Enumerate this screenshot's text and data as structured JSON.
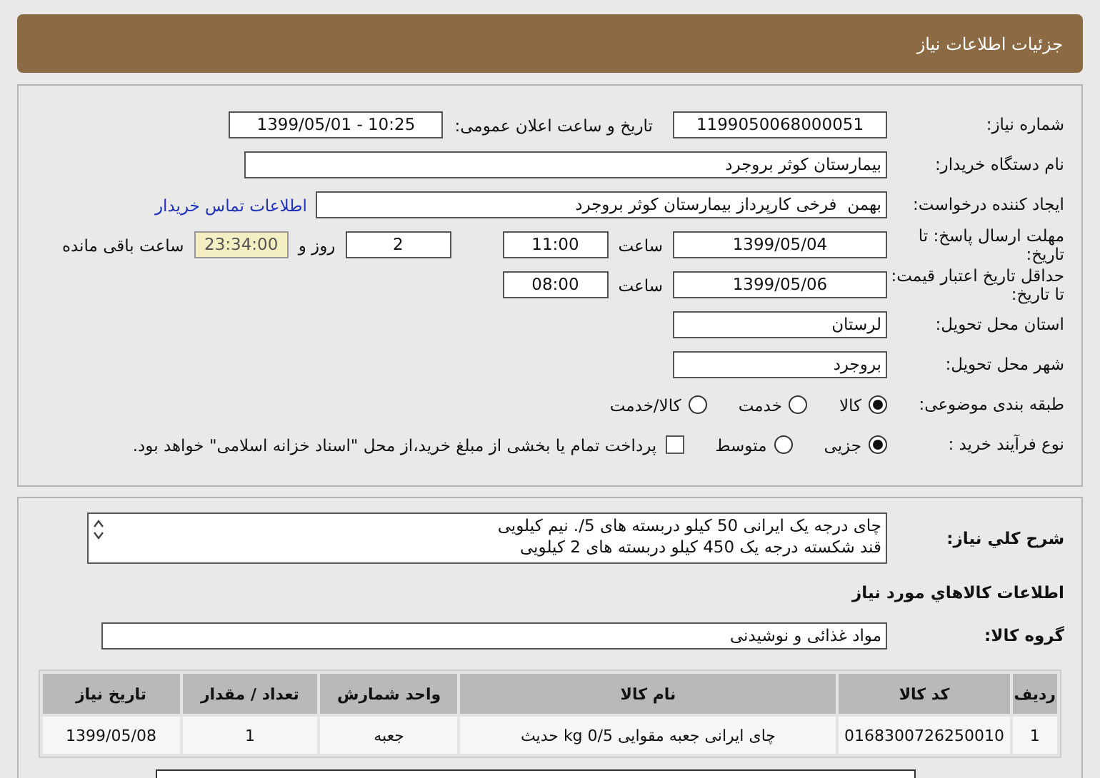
{
  "header": {
    "title": "جزئیات اطلاعات نیاز"
  },
  "need_number": {
    "label": "شماره نیاز:",
    "value": "1199050068000051"
  },
  "announce_datetime": {
    "label": "تاریخ و ساعت اعلان عمومی:",
    "value": "1399/05/01 - 10:25"
  },
  "buyer_org": {
    "label": "نام دستگاه خریدار:",
    "value": "بیمارستان کوثر بروجرد"
  },
  "requester": {
    "label": "ایجاد کننده درخواست:",
    "value": "بهمن  فرخی کارپرداز بیمارستان کوثر بروجرد",
    "link": "اطلاعات تماس خریدار"
  },
  "response_deadline": {
    "label": "مهلت ارسال پاسخ: تا تاریخ:",
    "date": "1399/05/04",
    "time_label": "ساعت",
    "time": "11:00",
    "days": "2",
    "days_label": "روز و",
    "remaining": "23:34:00",
    "remaining_label": "ساعت باقی مانده"
  },
  "price_validity": {
    "label": "حداقل تاریخ اعتبار قیمت: تا تاریخ:",
    "date": "1399/05/06",
    "time_label": "ساعت",
    "time": "08:00"
  },
  "province": {
    "label": "استان محل تحویل:",
    "value": "لرستان"
  },
  "city": {
    "label": "شهر محل تحویل:",
    "value": "بروجرد"
  },
  "category": {
    "label": "طبقه بندی موضوعی:",
    "options": [
      {
        "label": "کالا",
        "selected": true
      },
      {
        "label": "خدمت",
        "selected": false
      },
      {
        "label": "کالا/خدمت",
        "selected": false
      }
    ]
  },
  "process": {
    "label": "نوع فرآیند خرید :",
    "options": [
      {
        "label": "جزیی",
        "selected": true
      },
      {
        "label": "متوسط",
        "selected": false
      }
    ],
    "payment": {
      "checked": false,
      "label": "پرداخت تمام یا بخشی از مبلغ خرید،از محل \"اسناد خزانه اسلامی\" خواهد بود."
    }
  },
  "description": {
    "label": "شرح کلي نياز:",
    "lines": [
      "چای درجه یک ایرانی 50 کیلو دربسته های 5/. نیم کیلویی",
      "قند شکسته درجه یک 450 کیلو دربسته های 2 کیلویی"
    ]
  },
  "goods_heading": "اطلاعات کالاهاي مورد نياز",
  "goods_group": {
    "label": "گروه کالا:",
    "value": "مواد غذائی و نوشیدنی"
  },
  "table": {
    "columns": [
      "ردیف",
      "کد کالا",
      "نام کالا",
      "واحد شمارش",
      "تعداد / مقدار",
      "تاریخ نیاز"
    ],
    "rows": [
      [
        "1",
        "0168300726250010",
        "چای ایرانی جعبه مقوایی 0/5 kg حدیث",
        "جعبه",
        "1",
        "1399/05/08"
      ]
    ]
  }
}
